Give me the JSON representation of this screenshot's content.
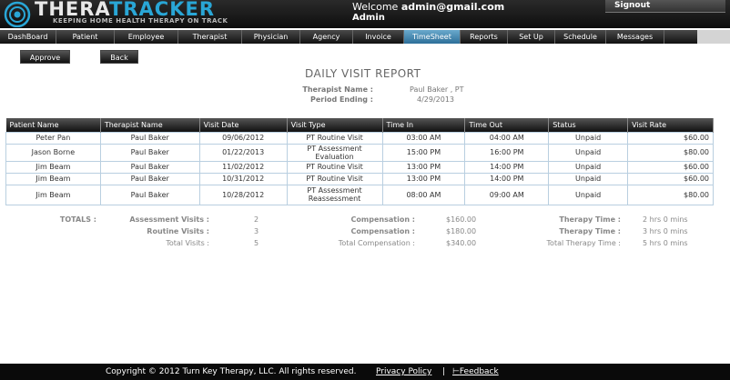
{
  "brand": {
    "name_part1": "THERA",
    "name_part2": "TRACKER",
    "tagline": "KEEPING HOME HEALTH THERAPY ON TRACK"
  },
  "header": {
    "welcome_prefix": "Welcome ",
    "user_email": "admin@gmail.com",
    "role": "Admin",
    "signout": "Signout"
  },
  "nav": [
    "DashBoard",
    "Patient",
    "Employee",
    "Therapist",
    "Physician",
    "Agency",
    "Invoice",
    "TimeSheet",
    "Reports",
    "Set Up",
    "Schedule",
    "Messages"
  ],
  "nav_active": "TimeSheet",
  "actions": {
    "approve": "Approve",
    "back": "Back"
  },
  "report": {
    "title": "DAILY VISIT REPORT",
    "therapist_label": "Therapist Name :",
    "therapist_value": "Paul Baker , PT",
    "period_label": "Period Ending :",
    "period_value": "4/29/2013"
  },
  "table": {
    "headers": [
      "Patient Name",
      "Therapist Name",
      "Visit Date",
      "Visit Type",
      "Time In",
      "Time Out",
      "Status",
      "Visit Rate"
    ],
    "rows": [
      [
        "Peter Pan",
        "Paul Baker",
        "09/06/2012",
        "PT Routine Visit",
        "03:00 AM",
        "04:00 AM",
        "Unpaid",
        "$60.00"
      ],
      [
        "Jason Borne",
        "Paul Baker",
        "01/22/2013",
        "PT Assessment Evaluation",
        "15:00 PM",
        "16:00 PM",
        "Unpaid",
        "$80.00"
      ],
      [
        "Jim Beam",
        "Paul Baker",
        "11/02/2012",
        "PT Routine Visit",
        "13:00 PM",
        "14:00 PM",
        "Unpaid",
        "$60.00"
      ],
      [
        "Jim Beam",
        "Paul Baker",
        "10/31/2012",
        "PT Routine Visit",
        "13:00 PM",
        "14:00 PM",
        "Unpaid",
        "$60.00"
      ],
      [
        "Jim Beam",
        "Paul Baker",
        "10/28/2012",
        "PT Assessment Reassessment",
        "08:00 AM",
        "09:00 AM",
        "Unpaid",
        "$80.00"
      ]
    ]
  },
  "totals": {
    "label": "TOTALS :",
    "assessment_label": "Assessment Visits :",
    "assessment_value": "2",
    "routine_label": "Routine Visits :",
    "routine_value": "3",
    "total_label": "Total Visits :",
    "total_value": "5",
    "comp1_label": "Compensation :",
    "comp1_value": "$160.00",
    "comp2_label": "Compensation :",
    "comp2_value": "$180.00",
    "comp_total_label": "Total Compensation :",
    "comp_total_value": "$340.00",
    "time1_label": "Therapy Time :",
    "time1_value": "2 hrs 0 mins",
    "time2_label": "Therapy Time :",
    "time2_value": "3 hrs 0 mins",
    "time_total_label": "Total Therapy Time :",
    "time_total_value": "5 hrs 0 mins"
  },
  "footer": {
    "copyright": "Copyright © 2012 Turn Key Therapy, LLC. All rights reserved.",
    "privacy": "Privacy Policy",
    "separator": "|",
    "feedback": "Feedback"
  },
  "colors": {
    "accent": "#29a6d6",
    "active_tab": "#4a8db8",
    "header_bg": "#1a1a1a"
  }
}
